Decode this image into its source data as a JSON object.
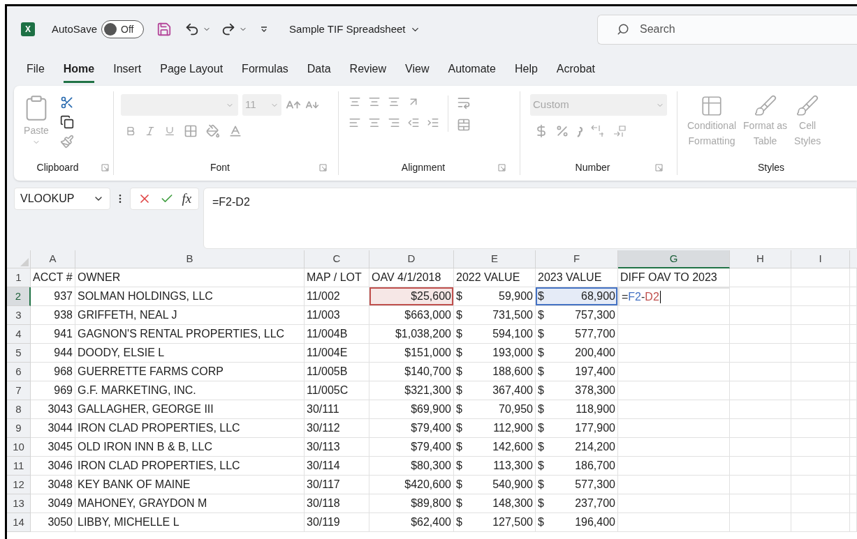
{
  "title_bar": {
    "app_icon_letter": "X",
    "autosave": {
      "label": "AutoSave",
      "on": false,
      "state_label": "Off"
    },
    "file_name": "Sample TIF Spreadsheet",
    "search": {
      "placeholder": "Search"
    }
  },
  "tabs": [
    {
      "label": "File",
      "selected": false
    },
    {
      "label": "Home",
      "selected": true
    },
    {
      "label": "Insert",
      "selected": false
    },
    {
      "label": "Page Layout",
      "selected": false
    },
    {
      "label": "Formulas",
      "selected": false
    },
    {
      "label": "Data",
      "selected": false
    },
    {
      "label": "Review",
      "selected": false
    },
    {
      "label": "View",
      "selected": false
    },
    {
      "label": "Automate",
      "selected": false
    },
    {
      "label": "Help",
      "selected": false
    },
    {
      "label": "Acrobat",
      "selected": false
    }
  ],
  "ribbon": {
    "disabled": true,
    "clipboard": {
      "paste_label": "Paste",
      "group_label": "Clipboard"
    },
    "font": {
      "size": "11",
      "group_label": "Font"
    },
    "alignment": {
      "group_label": "Alignment"
    },
    "number": {
      "format": "Custom",
      "group_label": "Number"
    },
    "styles": {
      "buttons": [
        {
          "line1": "Conditional",
          "line2": "Formatting"
        },
        {
          "line1": "Format as",
          "line2": "Table"
        },
        {
          "line1": "Cell",
          "line2": "Styles"
        }
      ],
      "group_label": "Styles"
    }
  },
  "formula_bar": {
    "name_box": "VLOOKUP",
    "function_label": "fx",
    "formula": "=F2-D2"
  },
  "sheet": {
    "columns": [
      {
        "label": "A",
        "selected": false
      },
      {
        "label": "B",
        "selected": false
      },
      {
        "label": "C",
        "selected": false
      },
      {
        "label": "D",
        "selected": false
      },
      {
        "label": "E",
        "selected": false
      },
      {
        "label": "F",
        "selected": false
      },
      {
        "label": "G",
        "selected": true
      },
      {
        "label": "H",
        "selected": false
      },
      {
        "label": "I",
        "selected": false
      }
    ],
    "rows": [
      {
        "number": "1",
        "selected": false,
        "cells": [
          {
            "kind": "text",
            "value": "ACCT #"
          },
          {
            "kind": "text",
            "value": "OWNER"
          },
          {
            "kind": "text",
            "value": "MAP / LOT"
          },
          {
            "kind": "text",
            "value": "OAV 4/1/2018"
          },
          {
            "kind": "text",
            "value": "2022 VALUE"
          },
          {
            "kind": "text",
            "value": "2023 VALUE"
          },
          {
            "kind": "text",
            "value": "DIFF OAV TO 2023"
          }
        ]
      },
      {
        "number": "2",
        "selected": true,
        "cells": [
          {
            "kind": "number",
            "value": "937"
          },
          {
            "kind": "text",
            "value": "SOLMAN HOLDINGS, LLC"
          },
          {
            "kind": "text",
            "value": "11/002"
          },
          {
            "kind": "number",
            "value": "$25,600",
            "color": "#c0504d"
          },
          {
            "kind": "accounting",
            "currency": "$",
            "value": "59,900"
          },
          {
            "kind": "accounting",
            "currency": "$",
            "value": "68,900",
            "color": "#4472c4"
          },
          {
            "kind": "formula",
            "parts": [
              {
                "text": "=",
                "color": "#333333"
              },
              {
                "text": "F2",
                "color": "#4472c4"
              },
              {
                "text": "-",
                "color": "#333333"
              },
              {
                "text": "D2",
                "color": "#c0504d"
              }
            ]
          }
        ]
      },
      {
        "number": "3",
        "selected": false,
        "cells": [
          {
            "kind": "number",
            "value": "938"
          },
          {
            "kind": "text",
            "value": "GRIFFETH, NEAL J"
          },
          {
            "kind": "text",
            "value": "11/003"
          },
          {
            "kind": "number",
            "value": "$663,000"
          },
          {
            "kind": "accounting",
            "currency": "$",
            "value": "731,500"
          },
          {
            "kind": "accounting",
            "currency": "$",
            "value": "757,300"
          }
        ]
      },
      {
        "number": "4",
        "selected": false,
        "cells": [
          {
            "kind": "number",
            "value": "941"
          },
          {
            "kind": "text",
            "value": "GAGNON'S RENTAL PROPERTIES, LLC"
          },
          {
            "kind": "text",
            "value": "11/004B"
          },
          {
            "kind": "number",
            "value": "$1,038,200"
          },
          {
            "kind": "accounting",
            "currency": "$",
            "value": "594,100"
          },
          {
            "kind": "accounting",
            "currency": "$",
            "value": "577,700"
          }
        ]
      },
      {
        "number": "5",
        "selected": false,
        "cells": [
          {
            "kind": "number",
            "value": "944"
          },
          {
            "kind": "text",
            "value": "DOODY, ELSIE L"
          },
          {
            "kind": "text",
            "value": "11/004E"
          },
          {
            "kind": "number",
            "value": "$151,000"
          },
          {
            "kind": "accounting",
            "currency": "$",
            "value": "193,000"
          },
          {
            "kind": "accounting",
            "currency": "$",
            "value": "200,400"
          }
        ]
      },
      {
        "number": "6",
        "selected": false,
        "cells": [
          {
            "kind": "number",
            "value": "968"
          },
          {
            "kind": "text",
            "value": "GUERRETTE FARMS CORP"
          },
          {
            "kind": "text",
            "value": "11/005B"
          },
          {
            "kind": "number",
            "value": "$140,700"
          },
          {
            "kind": "accounting",
            "currency": "$",
            "value": "188,600"
          },
          {
            "kind": "accounting",
            "currency": "$",
            "value": "197,400"
          }
        ]
      },
      {
        "number": "7",
        "selected": false,
        "cells": [
          {
            "kind": "number",
            "value": "969"
          },
          {
            "kind": "text",
            "value": "G.F. MARKETING, INC."
          },
          {
            "kind": "text",
            "value": "11/005C"
          },
          {
            "kind": "number",
            "value": "$321,300"
          },
          {
            "kind": "accounting",
            "currency": "$",
            "value": "367,400"
          },
          {
            "kind": "accounting",
            "currency": "$",
            "value": "378,300"
          }
        ]
      },
      {
        "number": "8",
        "selected": false,
        "cells": [
          {
            "kind": "number",
            "value": "3043"
          },
          {
            "kind": "text",
            "value": "GALLAGHER, GEORGE III"
          },
          {
            "kind": "text",
            "value": "30/111"
          },
          {
            "kind": "number",
            "value": "$69,900"
          },
          {
            "kind": "accounting",
            "currency": "$",
            "value": "70,950"
          },
          {
            "kind": "accounting",
            "currency": "$",
            "value": "118,900"
          }
        ]
      },
      {
        "number": "9",
        "selected": false,
        "cells": [
          {
            "kind": "number",
            "value": "3044"
          },
          {
            "kind": "text",
            "value": "IRON CLAD PROPERTIES, LLC"
          },
          {
            "kind": "text",
            "value": "30/112"
          },
          {
            "kind": "number",
            "value": "$79,400"
          },
          {
            "kind": "accounting",
            "currency": "$",
            "value": "112,900"
          },
          {
            "kind": "accounting",
            "currency": "$",
            "value": "177,900"
          }
        ]
      },
      {
        "number": "10",
        "selected": false,
        "cells": [
          {
            "kind": "number",
            "value": "3045"
          },
          {
            "kind": "text",
            "value": "OLD IRON INN B & B, LLC"
          },
          {
            "kind": "text",
            "value": "30/113"
          },
          {
            "kind": "number",
            "value": "$79,400"
          },
          {
            "kind": "accounting",
            "currency": "$",
            "value": "142,600"
          },
          {
            "kind": "accounting",
            "currency": "$",
            "value": "214,200"
          }
        ]
      },
      {
        "number": "11",
        "selected": false,
        "cells": [
          {
            "kind": "number",
            "value": "3046"
          },
          {
            "kind": "text",
            "value": "IRON CLAD PROPERTIES, LLC"
          },
          {
            "kind": "text",
            "value": "30/114"
          },
          {
            "kind": "number",
            "value": "$80,300"
          },
          {
            "kind": "accounting",
            "currency": "$",
            "value": "113,300"
          },
          {
            "kind": "accounting",
            "currency": "$",
            "value": "186,700"
          }
        ]
      },
      {
        "number": "12",
        "selected": false,
        "cells": [
          {
            "kind": "number",
            "value": "3048"
          },
          {
            "kind": "text",
            "value": "KEY BANK OF MAINE"
          },
          {
            "kind": "text",
            "value": "30/117"
          },
          {
            "kind": "number",
            "value": "$420,600"
          },
          {
            "kind": "accounting",
            "currency": "$",
            "value": "540,900"
          },
          {
            "kind": "accounting",
            "currency": "$",
            "value": "577,300"
          }
        ]
      },
      {
        "number": "13",
        "selected": false,
        "cells": [
          {
            "kind": "number",
            "value": "3049"
          },
          {
            "kind": "text",
            "value": "MAHONEY, GRAYDON M"
          },
          {
            "kind": "text",
            "value": "30/118"
          },
          {
            "kind": "number",
            "value": "$89,800"
          },
          {
            "kind": "accounting",
            "currency": "$",
            "value": "148,300"
          },
          {
            "kind": "accounting",
            "currency": "$",
            "value": "237,700"
          }
        ]
      },
      {
        "number": "14",
        "selected": false,
        "cells": [
          {
            "kind": "number",
            "value": "3050"
          },
          {
            "kind": "text",
            "value": "LIBBY, MICHELLE L"
          },
          {
            "kind": "text",
            "value": "30/119"
          },
          {
            "kind": "number",
            "value": "$62,400"
          },
          {
            "kind": "accounting",
            "currency": "$",
            "value": "127,500"
          },
          {
            "kind": "accounting",
            "currency": "$",
            "value": "196,400"
          }
        ]
      }
    ]
  }
}
